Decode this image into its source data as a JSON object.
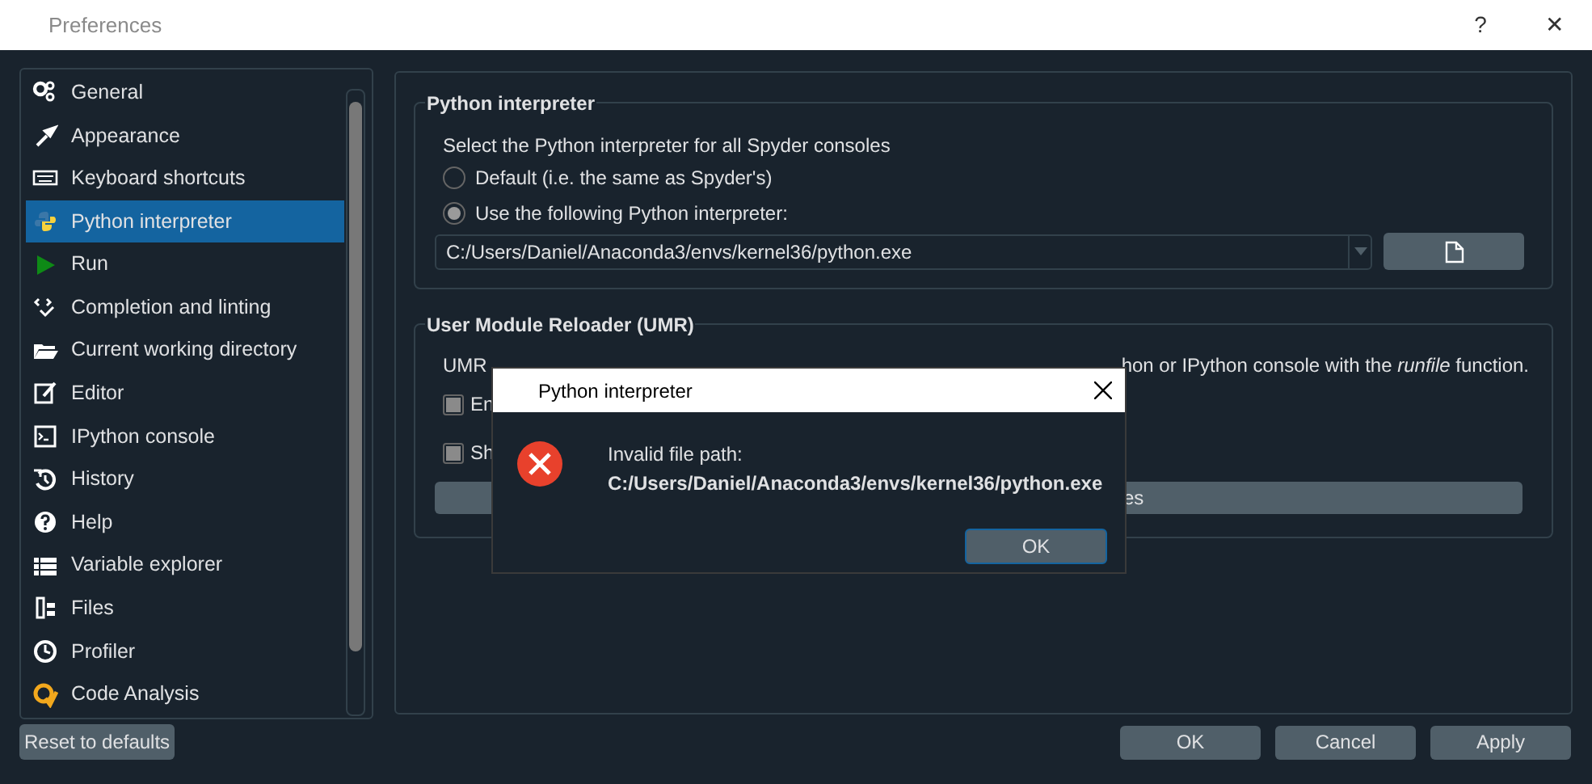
{
  "window": {
    "title": "Preferences",
    "buttons": [
      "?",
      "✕"
    ]
  },
  "sidebar": {
    "items": [
      {
        "label": "General",
        "selected": false
      },
      {
        "label": "Appearance",
        "selected": false
      },
      {
        "label": "Keyboard shortcuts",
        "selected": false
      },
      {
        "label": "Python interpreter",
        "selected": true
      },
      {
        "label": "Run",
        "selected": false
      },
      {
        "label": "Completion and linting",
        "selected": false
      },
      {
        "label": "Current working directory",
        "selected": false
      },
      {
        "label": "Editor",
        "selected": false
      },
      {
        "label": "IPython console",
        "selected": false
      },
      {
        "label": "History",
        "selected": false
      },
      {
        "label": "Help",
        "selected": false
      },
      {
        "label": "Variable explorer",
        "selected": false
      },
      {
        "label": "Files",
        "selected": false
      },
      {
        "label": "Profiler",
        "selected": false
      },
      {
        "label": "Code Analysis",
        "selected": false
      }
    ],
    "reset_button": "Reset to defaults"
  },
  "python_interpreter": {
    "title": "Python interpreter",
    "description": "Select the Python interpreter for all Spyder consoles",
    "options": [
      {
        "label": "Default (i.e. the same as Spyder's)",
        "selected": false
      },
      {
        "label": "Use the following Python interpreter:",
        "selected": true
      }
    ],
    "path": "C:/Users/Daniel/Anaconda3/envs/kernel36/python.exe"
  },
  "umr": {
    "title": "User Module Reloader (UMR)",
    "description_start": "UMR",
    "description_end": "hon or IPython console with the *runfile* function.",
    "checkboxes": [
      {
        "label": "En",
        "checked": true
      },
      {
        "label": "Sh",
        "checked": true
      }
    ],
    "button": "es"
  },
  "dialog": {
    "title": "Python interpreter",
    "message": "Invalid file path:",
    "path": "C:/Users/Daniel/Anaconda3/envs/kernel36/python.exe",
    "button": "OK"
  },
  "buttons": [
    "OK",
    "Cancel",
    "Apply"
  ]
}
